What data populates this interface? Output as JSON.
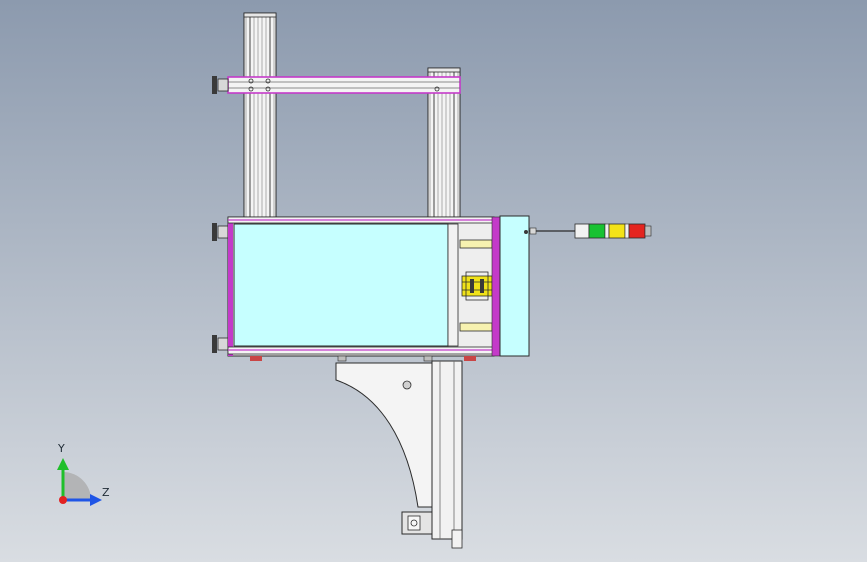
{
  "viewport": {
    "background_top": "#8c9aae",
    "background_bottom": "#d9dde2"
  },
  "colors": {
    "cabinet_fill": "#c6ffff",
    "frame_magenta": "#c43ac9",
    "extrusion_fill": "#f4f4f4",
    "line": "#2b2b2b",
    "light_beige": "#f7f2b0",
    "yellow": "#f0e21a",
    "signal_green": "#18c232",
    "signal_yellow": "#f3e318",
    "signal_red": "#e4241f",
    "axis_y": "#1fbf2a",
    "axis_z": "#1f55e6",
    "axis_origin": "#e22222",
    "red_foot": "#c94545"
  },
  "triad": {
    "y_label": "Y",
    "z_label": "Z"
  }
}
